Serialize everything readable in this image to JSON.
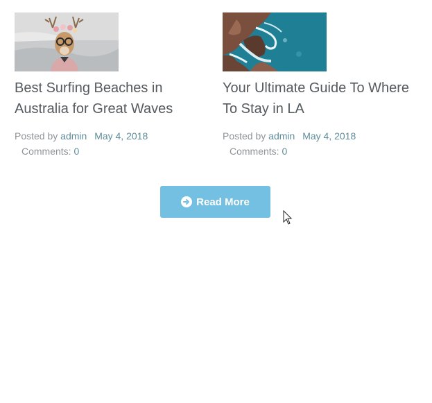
{
  "posts": [
    {
      "title": "Best Surfing Beaches in Australia for Great Waves",
      "posted_by_label": "Posted by",
      "author": "admin",
      "date": "May 4, 2018",
      "comments_label": "Comments:",
      "comments_count": "0",
      "thumbnail_icon": "deer-illustration-image"
    },
    {
      "title": "Your Ultimate Guide To Where To Stay in LA",
      "posted_by_label": "Posted by",
      "author": "admin",
      "date": "May 4, 2018",
      "comments_label": "Comments:",
      "comments_count": "0",
      "thumbnail_icon": "coastline-aerial-image"
    }
  ],
  "read_more": {
    "label": "Read More",
    "icon": "arrow-circle-right-icon",
    "color": "#74c0e2"
  },
  "colors": {
    "title": "#555a5e",
    "meta": "#8f9497",
    "link": "#5f8d9c"
  }
}
